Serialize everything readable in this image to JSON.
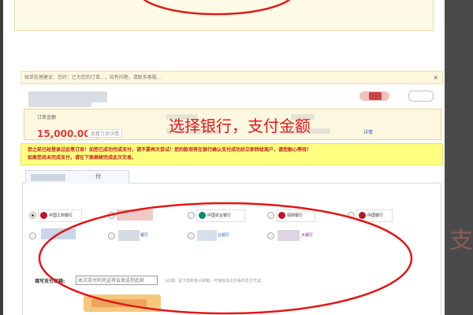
{
  "tip_bar": {
    "text": "账单处理建议：您好：已为您的订单...，如有问题，请联系客服...",
    "close": "×"
  },
  "order": {
    "amount_label": "订单金额",
    "amount": "15,000.00元",
    "amount_link": "查看订单详情",
    "details_link": "详情"
  },
  "banner": "选择银行，支付金额",
  "warning": {
    "line1": "您之前已经登录过此笔订单！如您已成功完成支付，请不要再次尝试！您的款项将在银行确认支付成功后立即转给商户，请您耐心等待！",
    "line2": "如果您尚未完成支付，请在下面继续完成此次交易。"
  },
  "tab": {
    "label": "付"
  },
  "banks": [
    {
      "name": "中国工商银行",
      "selected": true,
      "color": "#c8102e"
    },
    {
      "name": "",
      "selected": false,
      "color": "#d03030"
    },
    {
      "name": "中国农业银行",
      "selected": false,
      "color": "#0e8a6a"
    },
    {
      "name": "招商银行",
      "selected": false,
      "color": "#c8102e"
    },
    {
      "name": "中国银行",
      "selected": false,
      "color": "#b3182c"
    },
    {
      "name": "",
      "selected": false,
      "color": "#2266bb"
    },
    {
      "name": "银行",
      "selected": false,
      "color": "#1d4f9a"
    },
    {
      "name": "业银行",
      "selected": false,
      "color": "#1c6fb8"
    },
    {
      "name": "大银行",
      "selected": false,
      "color": "#6a2c7a"
    }
  ],
  "email": {
    "label": "填写支付邮箱:",
    "placeholder": "本次支付的凭证将会发送到此邮",
    "hint": "（必填）留下您的电子邮箱，可接收本次交易的支付凭证。"
  },
  "colors": {
    "annotation_red": "#e01818",
    "warning_bg": "#ffff80",
    "amount_red": "#e4393c"
  }
}
